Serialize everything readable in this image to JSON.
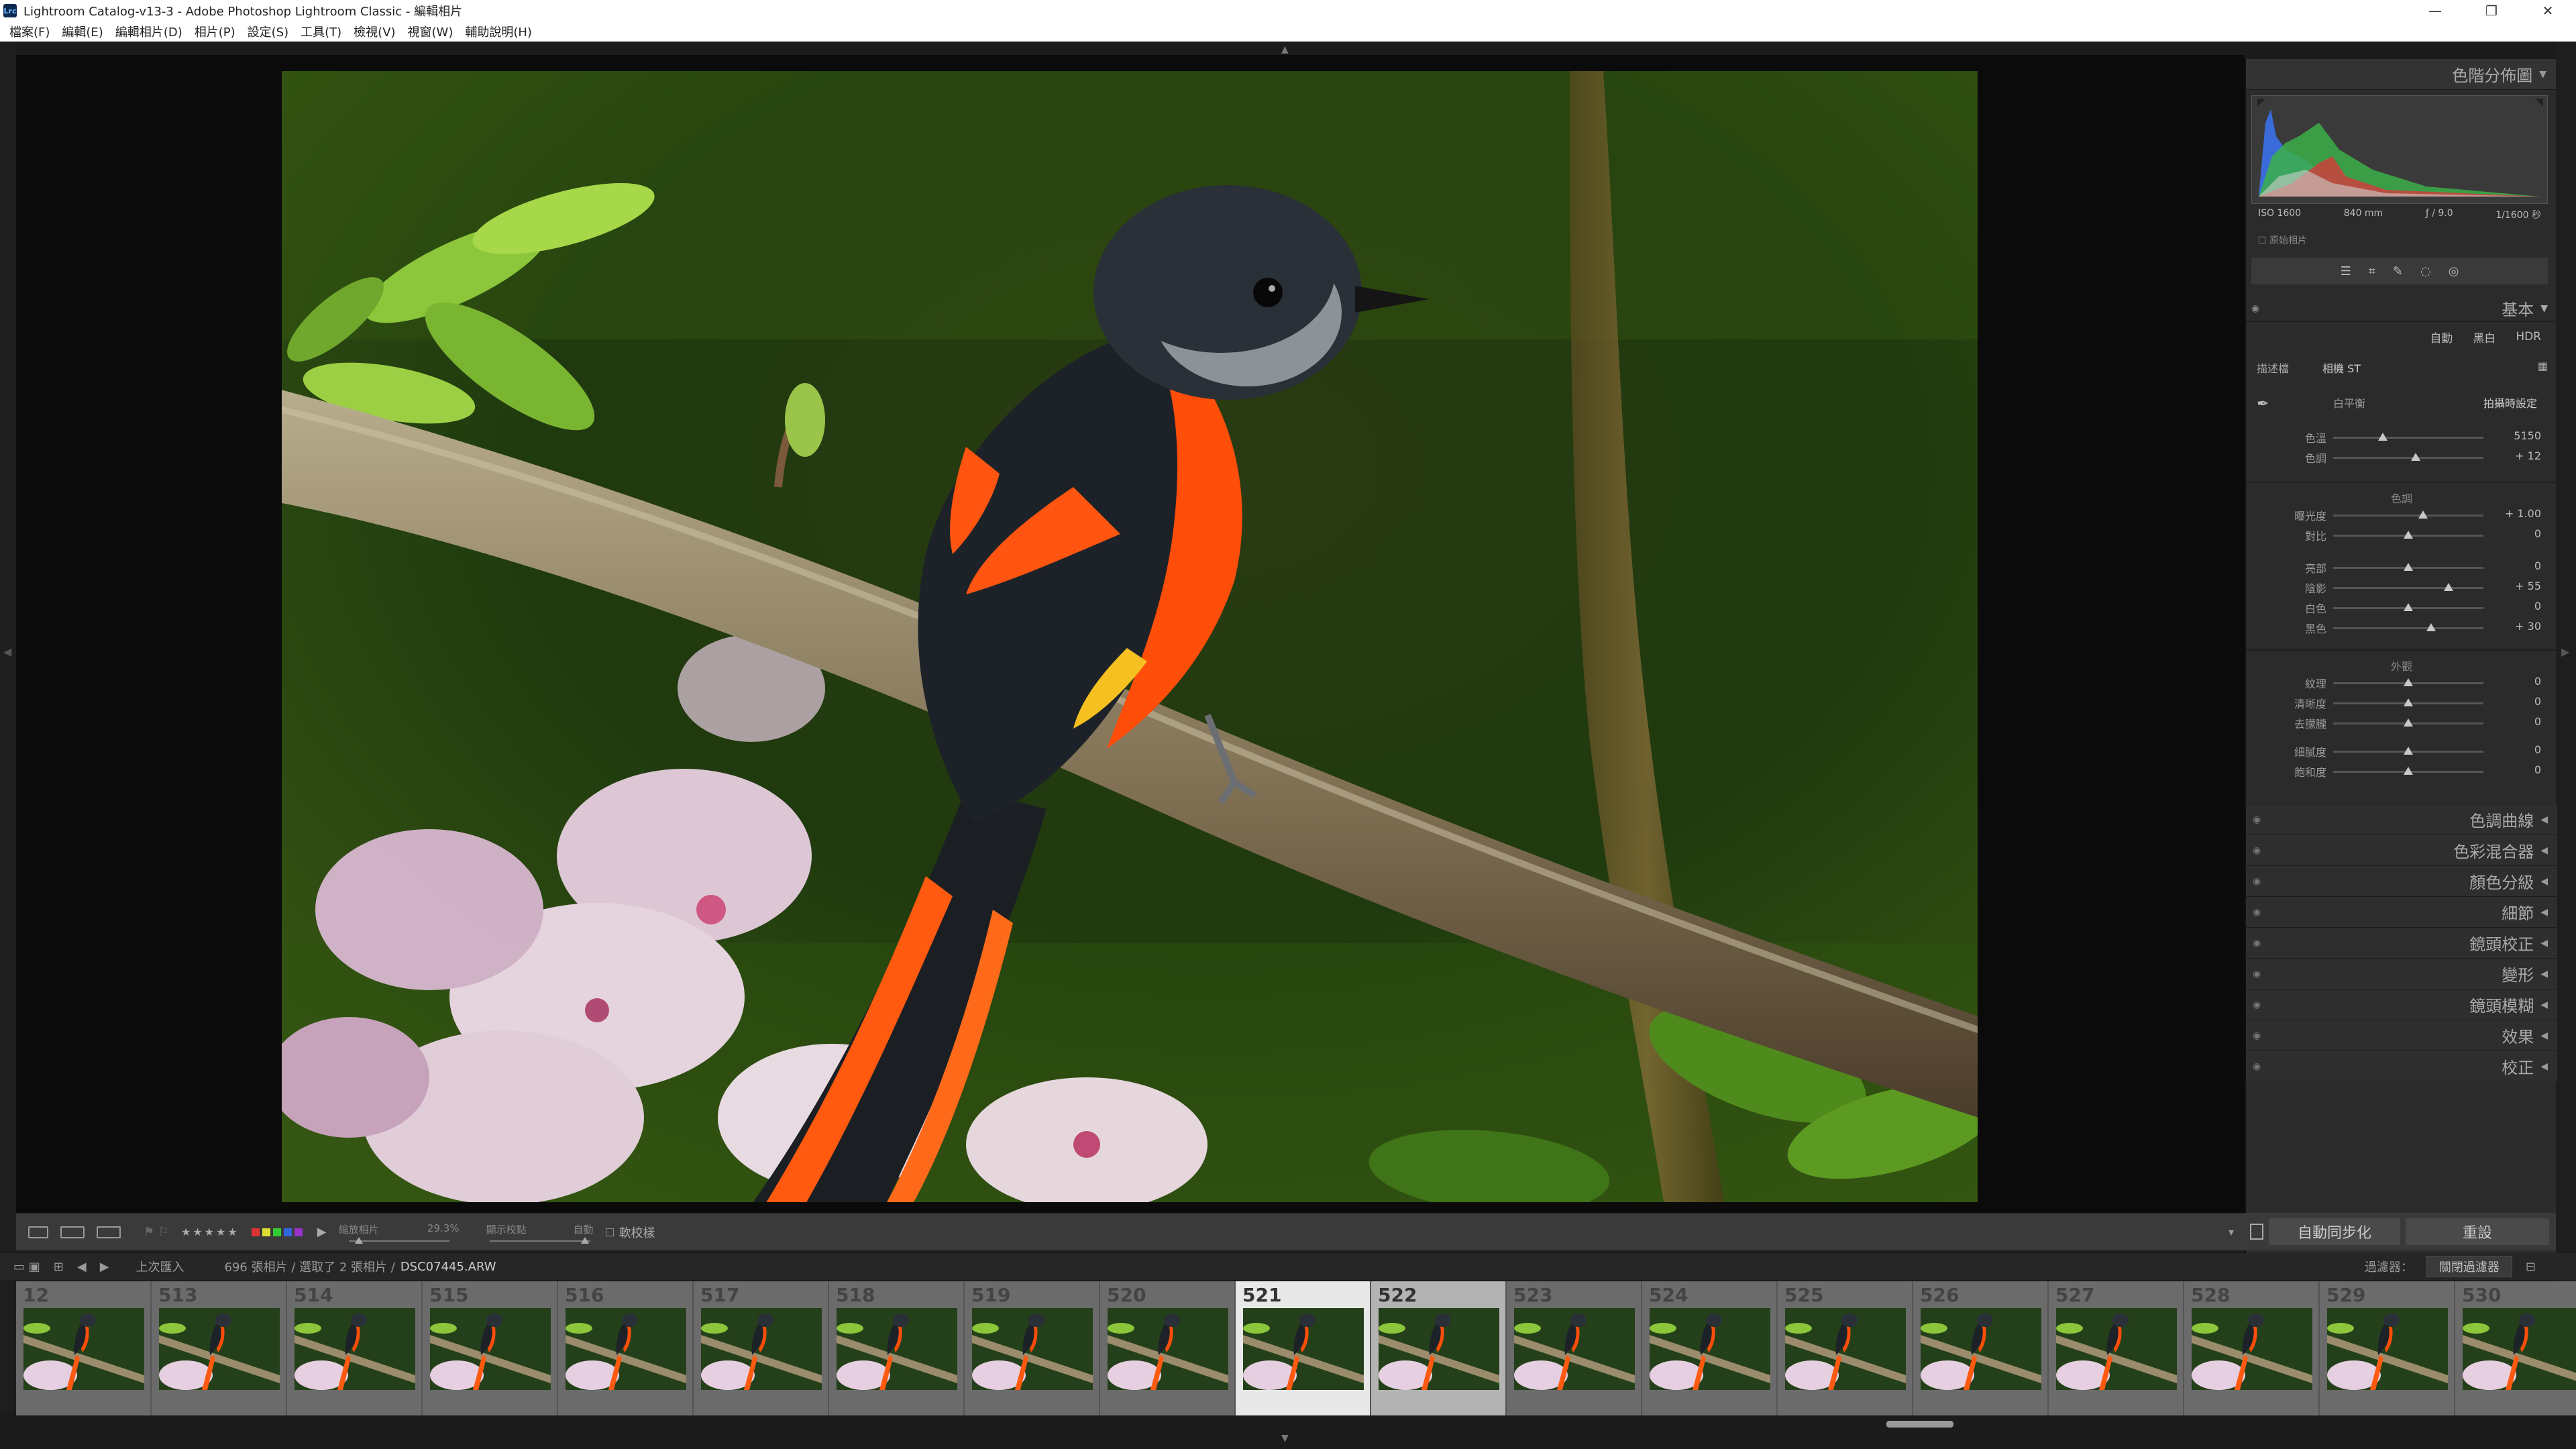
{
  "window": {
    "title": "Lightroom Catalog-v13-3 - Adobe Photoshop Lightroom Classic - 編輯相片",
    "app_badge": "Lrc",
    "controls": {
      "minimize": "—",
      "maximize": "❐",
      "close": "✕"
    }
  },
  "menu": [
    "檔案(F)",
    "編輯(E)",
    "編輯相片(D)",
    "相片(P)",
    "設定(S)",
    "工具(T)",
    "檢視(V)",
    "視窗(W)",
    "輔助說明(H)"
  ],
  "toolbar": {
    "stars": "★★★★★",
    "color_labels": [
      "#d33",
      "#dd3",
      "#3c3",
      "#36d",
      "#93c"
    ],
    "zoom_label": "縮放相片",
    "zoom_value": "29.3%",
    "zoom_fraction": 0.1,
    "mode_label": "顯示校點",
    "mode_value": "自動",
    "mode_fraction": 0.95,
    "soft_proof": "軟校樣"
  },
  "right_panel": {
    "histogram_title": "色階分佈圖",
    "iso": "ISO 1600",
    "focal": "840 mm",
    "aperture": "ƒ / 9.0",
    "shutter": "1/1600 秒",
    "original_photo": "原始相片",
    "basic_title": "基本",
    "treatment": [
      "自動",
      "黑白",
      "HDR"
    ],
    "profile_label": "描述檔",
    "profile_value": "相機 ST",
    "wb_label": "白平衡",
    "wb_value": "拍攝時設定",
    "sliders_wb": [
      {
        "label": "色溫",
        "value": "5150",
        "pos": 0.33
      },
      {
        "label": "色調",
        "value": "+ 12",
        "pos": 0.55
      }
    ],
    "tone_title": "色調",
    "sliders_tone": [
      {
        "label": "曝光度",
        "value": "+ 1.00",
        "pos": 0.6
      },
      {
        "label": "對比",
        "value": "0",
        "pos": 0.5
      },
      {
        "label": "亮部",
        "value": "0",
        "pos": 0.5
      },
      {
        "label": "陰影",
        "value": "+ 55",
        "pos": 0.77
      },
      {
        "label": "白色",
        "value": "0",
        "pos": 0.5
      },
      {
        "label": "黑色",
        "value": "+ 30",
        "pos": 0.65
      }
    ],
    "presence_title": "外觀",
    "sliders_presence": [
      {
        "label": "紋理",
        "value": "0",
        "pos": 0.5
      },
      {
        "label": "清晰度",
        "value": "0",
        "pos": 0.5
      },
      {
        "label": "去朦朧",
        "value": "0",
        "pos": 0.5
      },
      {
        "label": "細膩度",
        "value": "0",
        "pos": 0.5
      },
      {
        "label": "飽和度",
        "value": "0",
        "pos": 0.5
      }
    ],
    "collapsed_panels": [
      "色調曲線",
      "色彩混合器",
      "顏色分級",
      "細節",
      "鏡頭校正",
      "變形",
      "鏡頭模糊",
      "效果",
      "校正"
    ],
    "btn_sync": "自動同步化",
    "btn_reset": "重設"
  },
  "film_header": {
    "prev_import": "上次匯入",
    "summary": "696 張相片 / 選取了 2 張相片 /",
    "filename": "DSC07445.ARW",
    "filter_label": "過濾器：",
    "filter_value": "關閉過濾器"
  },
  "filmstrip": [
    {
      "num": "12",
      "state": "normal"
    },
    {
      "num": "513",
      "state": "normal"
    },
    {
      "num": "514",
      "state": "normal"
    },
    {
      "num": "515",
      "state": "normal"
    },
    {
      "num": "516",
      "state": "normal"
    },
    {
      "num": "517",
      "state": "normal"
    },
    {
      "num": "518",
      "state": "normal"
    },
    {
      "num": "519",
      "state": "normal"
    },
    {
      "num": "520",
      "state": "normal"
    },
    {
      "num": "521",
      "state": "active"
    },
    {
      "num": "522",
      "state": "selected"
    },
    {
      "num": "523",
      "state": "normal"
    },
    {
      "num": "524",
      "state": "normal"
    },
    {
      "num": "525",
      "state": "normal"
    },
    {
      "num": "526",
      "state": "normal"
    },
    {
      "num": "527",
      "state": "normal"
    },
    {
      "num": "528",
      "state": "normal"
    },
    {
      "num": "529",
      "state": "normal"
    },
    {
      "num": "530",
      "state": "normal"
    }
  ]
}
